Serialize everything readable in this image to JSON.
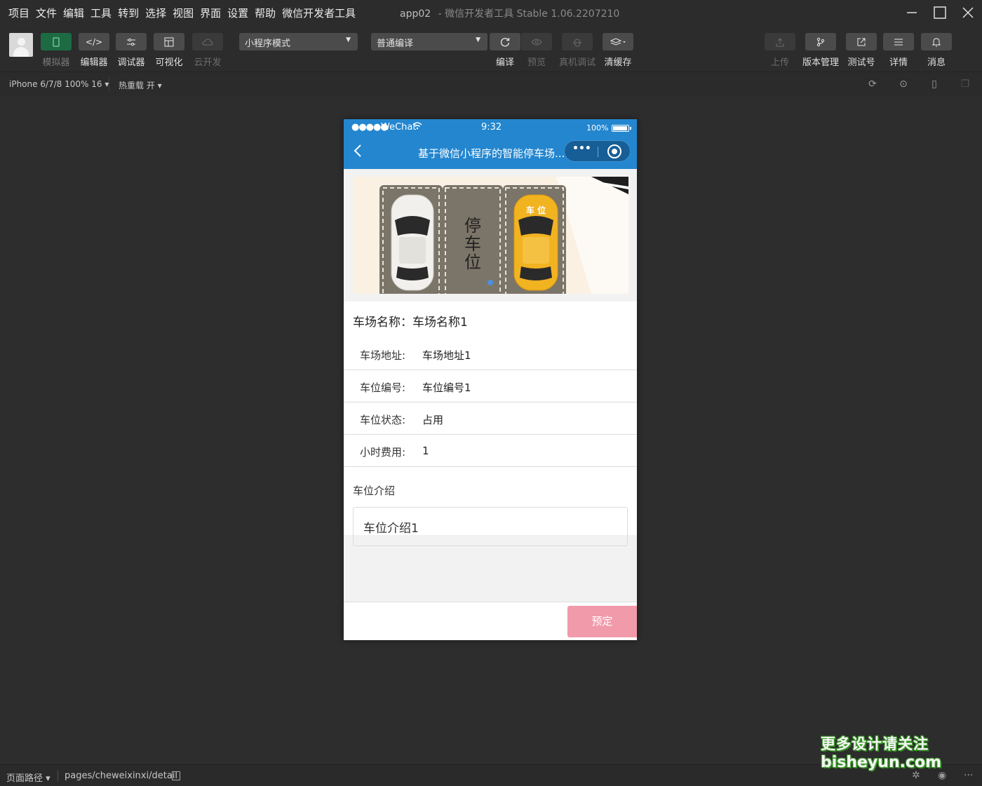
{
  "menu": {
    "items": [
      "项目",
      "文件",
      "编辑",
      "工具",
      "转到",
      "选择",
      "视图",
      "界面",
      "设置",
      "帮助",
      "微信开发者工具"
    ]
  },
  "window": {
    "app_name": "app02",
    "title_suffix": "-  微信开发者工具 Stable 1.06.2207210"
  },
  "toolbar": {
    "simulator": "模拟器",
    "editor": "编辑器",
    "debugger": "调试器",
    "visual": "可视化",
    "cloud": "云开发",
    "mode_select": "小程序模式",
    "compile_select": "普通编译",
    "compile": "编译",
    "preview": "预览",
    "real_debug": "真机调试",
    "clear_cache": "清缓存",
    "upload": "上传",
    "version": "版本管理",
    "test_account": "测试号",
    "details": "详情",
    "messages": "消息"
  },
  "subbar": {
    "device": "iPhone 6/7/8 100% 16 ▾",
    "hot_reload": "热重载 开 ▾"
  },
  "phone": {
    "status": {
      "signal": "●●●●●",
      "carrier": "WeChat",
      "time": "9:32",
      "battery_pct": "100%"
    },
    "nav": {
      "title": "基于微信小程序的智能停车场...",
      "more": "•••"
    },
    "banner": {
      "sign_text": [
        "停",
        "车",
        "位"
      ],
      "car_label": "车 位"
    },
    "detail": {
      "name_label": "车场名称：",
      "name_value": "车场名称1",
      "rows": [
        {
          "label": "车场地址:",
          "value": "车场地址1"
        },
        {
          "label": "车位编号:",
          "value": "车位编号1"
        },
        {
          "label": "车位状态:",
          "value": "占用"
        },
        {
          "label": "小时费用:",
          "value": "1"
        }
      ],
      "intro_title": "车位介绍",
      "intro_value": "车位介绍1"
    },
    "book_button": "预定"
  },
  "bottombar": {
    "path_label": "页面路径 ▾",
    "path": "pages/cheweixinxi/detail"
  },
  "watermark": {
    "line1": "更多设计请关注",
    "line2": "bisheyun.com"
  }
}
